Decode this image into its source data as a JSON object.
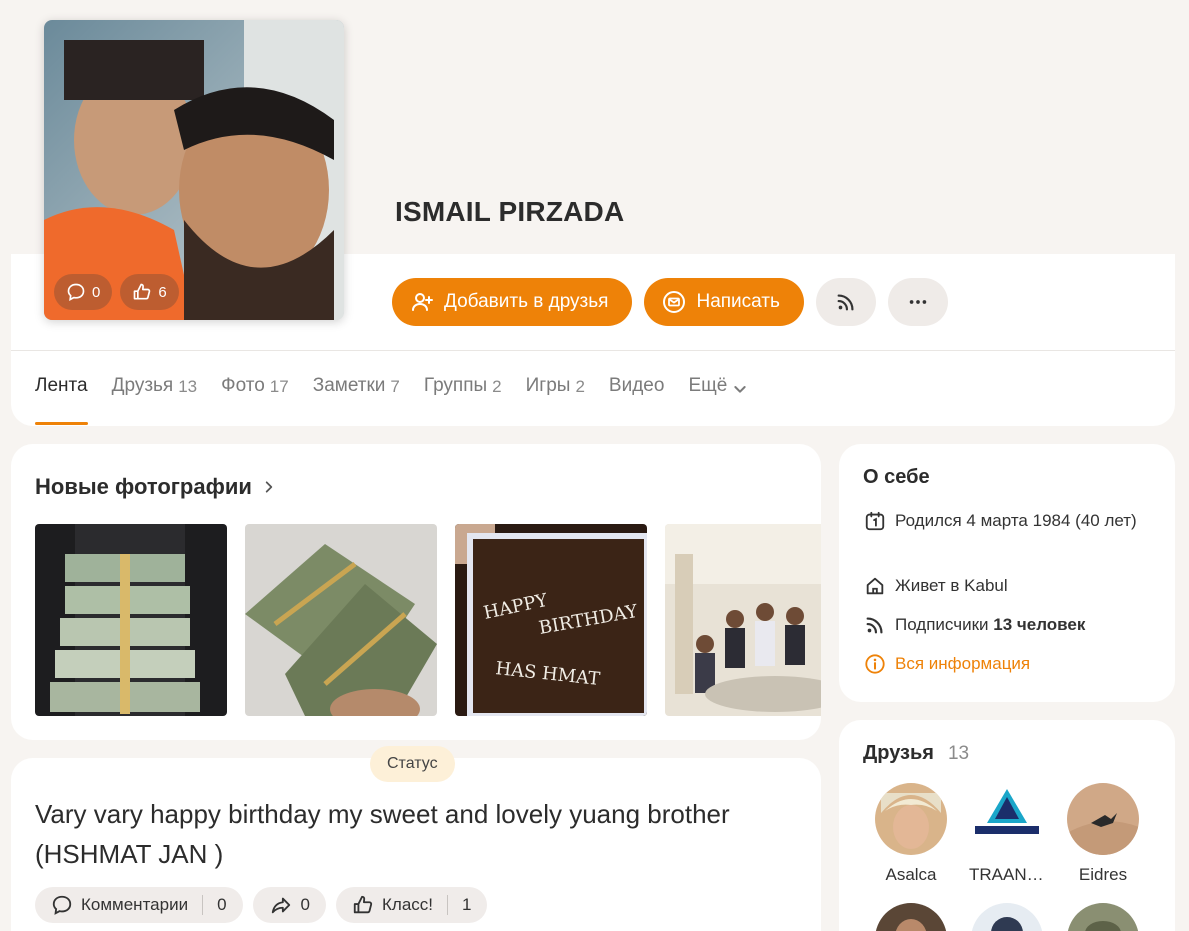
{
  "profile": {
    "name": "ISMAIL PIRZADA",
    "avatar": {
      "comments": "0",
      "likes": "6"
    }
  },
  "actions": {
    "add_friend": "Добавить в друзья",
    "write": "Написать"
  },
  "tabs": [
    {
      "label": "Лента",
      "count": ""
    },
    {
      "label": "Друзья",
      "count": "13"
    },
    {
      "label": "Фото",
      "count": "17"
    },
    {
      "label": "Заметки",
      "count": "7"
    },
    {
      "label": "Группы",
      "count": "2"
    },
    {
      "label": "Игры",
      "count": "2"
    },
    {
      "label": "Видео",
      "count": ""
    },
    {
      "label": "Ещё",
      "count": ""
    }
  ],
  "photos": {
    "title": "Новые фотографии"
  },
  "status": {
    "badge": "Статус",
    "text": "Vary vary happy birthday my sweet and lovely yuang brother (HSHMAT JAN )",
    "comments_label": "Комментарии",
    "comments_count": "0",
    "shares_count": "0",
    "like_label": "Класс!",
    "like_count": "1"
  },
  "about": {
    "title": "О себе",
    "born": "Родился 4 марта 1984 (40 лет)",
    "lives": "Живет в Kabul",
    "subscribers_label": "Подписчики",
    "subscribers_value": "13 человек",
    "all_info": "Вся информация"
  },
  "friends": {
    "title": "Друзья",
    "count": "13",
    "items": [
      {
        "name": "Asalca"
      },
      {
        "name": "TRAANSMEDIA"
      },
      {
        "name": "Eidres"
      }
    ]
  },
  "colors": {
    "accent": "#ee8208",
    "background": "#f7f4f1"
  }
}
